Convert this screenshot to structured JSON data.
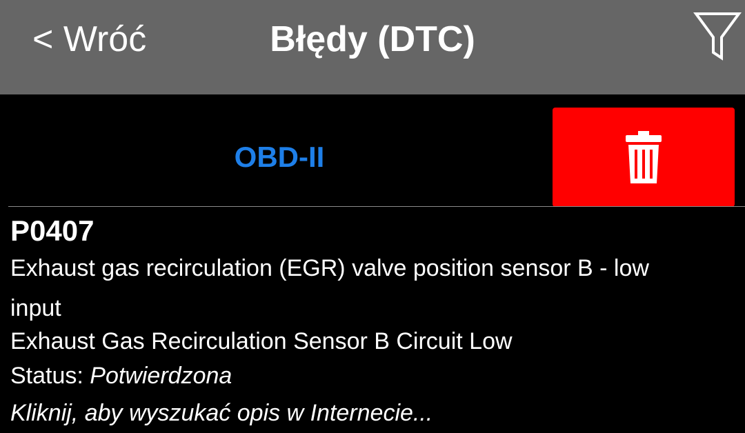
{
  "header": {
    "back_label": "< Wróć",
    "title": "Błędy (DTC)",
    "filter_icon": "filter-icon"
  },
  "toolbar": {
    "protocol_label": "OBD-II",
    "delete_icon": "trash-icon"
  },
  "dtc_items": [
    {
      "code": "P0407",
      "description": "Exhaust gas recirculation (EGR) valve position sensor B - low input",
      "description_alt": "Exhaust Gas Recirculation Sensor B Circuit Low",
      "status_label": "Status: ",
      "status_value": "Potwierdzona",
      "search_hint": "Kliknij, aby wyszukać opis w Internecie..."
    }
  ],
  "colors": {
    "topbar": "#666666",
    "background": "#000000",
    "accent_blue": "#1e7fe8",
    "delete_red": "#ff0000"
  }
}
